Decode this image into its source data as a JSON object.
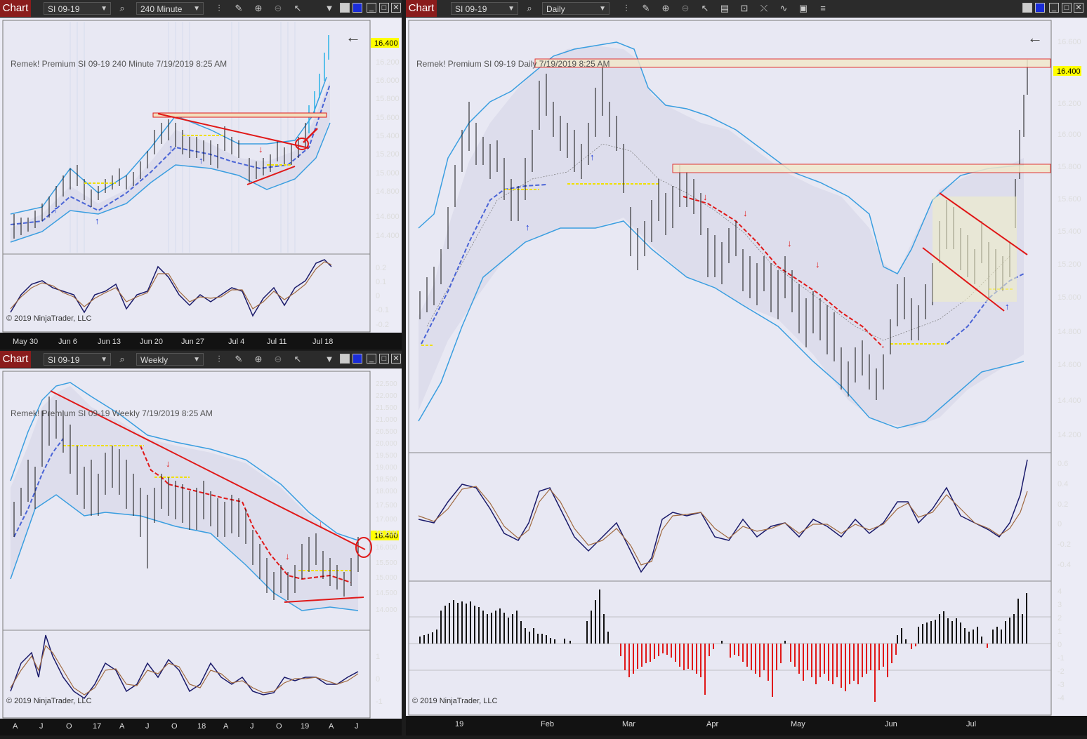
{
  "windows": {
    "tl": {
      "title": "Chart",
      "instrument": "SI 09-19",
      "interval": "240 Minute",
      "label": "Remek!  Premium  SI 09-19  240 Minute  7/19/2019 8:25 AM",
      "price_tag": "16.400",
      "copyright": "© 2019 NinjaTrader, LLC",
      "price_axis": [
        "16.200",
        "16.000",
        "15.800",
        "15.600",
        "15.400",
        "15.200",
        "15.000",
        "14.800",
        "14.600",
        "14.400"
      ],
      "osc_axis": [
        "0.2",
        "0.1",
        "0",
        "-0.1",
        "-0.2"
      ],
      "time_axis": [
        "May 30",
        "Jun 6",
        "Jun 13",
        "Jun 20",
        "Jun 27",
        "Jul 4",
        "Jul 11",
        "Jul 18"
      ]
    },
    "bl": {
      "title": "Chart",
      "instrument": "SI 09-19",
      "interval": "Weekly",
      "label": "Remek!  Premium  SI 09-19  Weekly  7/19/2019 8:25 AM",
      "price_tag": "16.400",
      "copyright": "© 2019 NinjaTrader, LLC",
      "price_axis": [
        "22.500",
        "22.000",
        "21.500",
        "21.000",
        "20.500",
        "20.000",
        "19.500",
        "19.000",
        "18.500",
        "18.000",
        "17.500",
        "17.000",
        "16.500",
        "16.000",
        "15.500",
        "15.000",
        "14.500",
        "14.000"
      ],
      "osc_axis": [
        "1",
        "0",
        "-1"
      ],
      "time_axis": [
        "A",
        "J",
        "O",
        "17",
        "A",
        "J",
        "O",
        "18",
        "A",
        "J",
        "O",
        "19",
        "A",
        "J"
      ]
    },
    "right": {
      "title": "Chart",
      "instrument": "SI 09-19",
      "interval": "Daily",
      "label": "Remek!  Premium  SI 09-19  Daily  7/19/2019 8:25 AM",
      "price_tag": "16.400",
      "copyright": "© 2019 NinjaTrader, LLC",
      "price_axis": [
        "16.600",
        "16.200",
        "16.000",
        "15.800",
        "15.600",
        "15.400",
        "15.200",
        "15.000",
        "14.800",
        "14.600",
        "14.400",
        "14.200"
      ],
      "osc_axis": [
        "0.6",
        "0.4",
        "0.2",
        "0",
        "-0.2",
        "-0.4"
      ],
      "hist_axis": [
        "4",
        "3",
        "2",
        "1",
        "0",
        "-1",
        "-2",
        "-3",
        "-4"
      ],
      "time_axis": [
        "19",
        "Feb",
        "Mar",
        "Apr",
        "May",
        "Jun",
        "Jul"
      ]
    }
  },
  "colors": {
    "title_red": "#8a1c1c",
    "bg_chart": "#ececf6",
    "band_blue": "#3a9ee0",
    "trend_red": "#e01818",
    "price_tag_yellow": "#ffff00"
  },
  "icons": [
    "search-icon",
    "bar-type-icon",
    "drawing-pencil-icon",
    "zoom-in-icon",
    "zoom-out-icon",
    "cursor-icon",
    "dropdown-arrow-icon"
  ]
}
